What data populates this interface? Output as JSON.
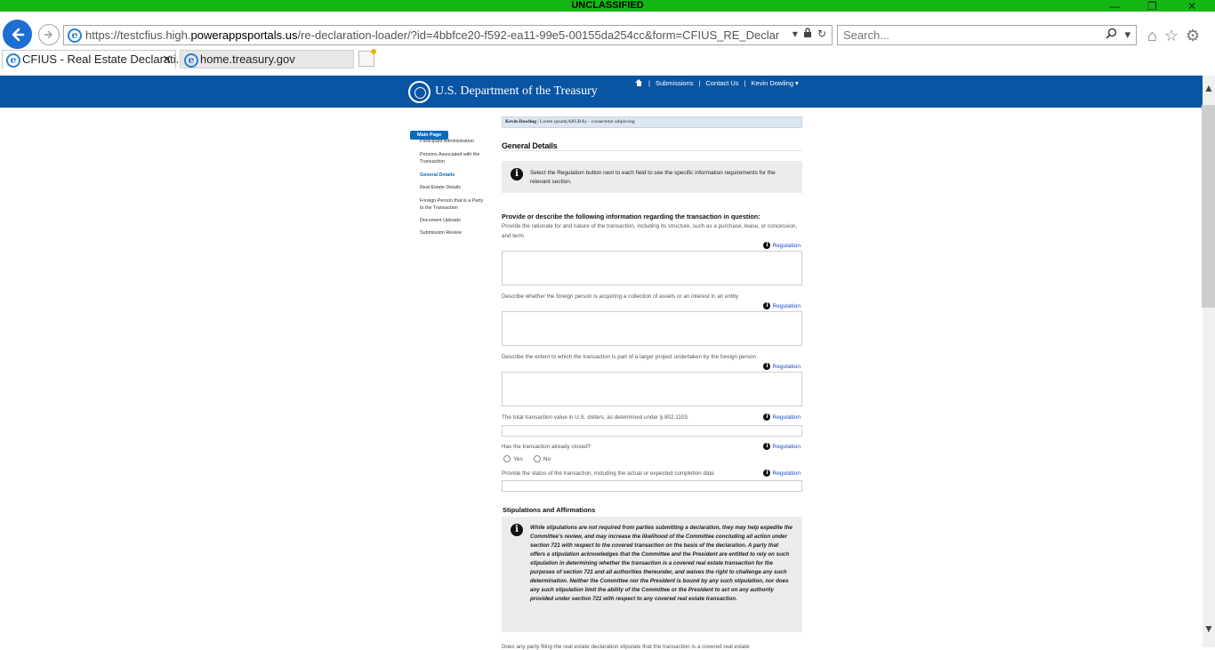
{
  "banner": {
    "text": "UNCLASSIFIED"
  },
  "browser": {
    "url": "https://testcfius.high.powerappsportals.us/re-declaration-loader/?id=4bbfce20-f592-ea11-99e5-00155da254cc&form=CFIUS_RE_Declaration_Gen_De",
    "url_prefix": "https://testcfius.high.",
    "url_domain": "powerappsportals.us",
    "url_path": "/re-declaration-loader/?id=4bbfce20-f592-ea11-99e5-00155da254cc&form=CFIUS_RE_Declaration_Gen_De",
    "search_placeholder": "Search...",
    "tabs": [
      {
        "label": "CFIUS - Real Estate Declarati...",
        "active": true
      },
      {
        "label": "home.treasury.gov",
        "active": false
      }
    ]
  },
  "header": {
    "dept_name": "U.S. Department of the Treasury",
    "nav": [
      "Submissions",
      "Contact Us",
      "Kevin Dowling"
    ],
    "nav_user_caret": "⌵"
  },
  "leftnav": {
    "main_page": "Main Page",
    "items": [
      {
        "label": "Participant Administration",
        "active": false
      },
      {
        "label": "Persons Associated with the Transaction",
        "active": false
      },
      {
        "label": "General Details",
        "active": true
      },
      {
        "label": "Real Estate Details",
        "active": false
      },
      {
        "label": "Foreign Person that is a Party to the Transaction",
        "active": false
      },
      {
        "label": "Document Uploads",
        "active": false
      },
      {
        "label": "Submission Review",
        "active": false
      }
    ]
  },
  "content": {
    "user_name": "Kevin Dowling",
    "user_detail": "Lorem ipsum(ARUBA) – consectetur adipiscing",
    "title": "General Details",
    "info_text": "Select the Regulation button next to each field to see the specific information requirements for the relevant section.",
    "provide_heading": "Provide or describe the following information regarding the transaction in question:",
    "regulation_label": "Regulation",
    "questions": [
      "Provide the rationale for and nature of the transaction, including its structure, such as a purchase, lease, or concession, and term",
      "Describe whether the foreign person is acquiring a collection of assets or an interest in an entity",
      "Describe the extent to which the transaction is part of a larger project undertaken by the foreign person",
      "The total transaction value in U.S. dollars, as determined under § 802.1103.",
      "Has the transaction already closed?",
      "Provide the status of the transaction, including the actual or expected completion date"
    ],
    "radio_yes": "Yes",
    "radio_no": "No",
    "stipulations_heading": "Stipulations and Affirmations",
    "stipulations_text": "While stipulations are not required from parties submitting a declaration, they may help expedite the Committee's review, and may increase the likelihood of the Committee concluding all action under section 721 with respect to the covered transaction on the basis of the declaration. A party that offers a stipulation acknowledges that the Committee and the President are entitled to rely on such stipulation in determining whether the transaction is a covered real estate transaction for the purposes of section 721 and all authorities thereunder, and waives the right to challenge any such determination. Neither the Committee nor the President is bound by any such stipulation, nor does any such stipulation limit the ability of the Committee or the President to act on any authority provided under section 721 with respect to any covered real estate transaction.",
    "cut_text": "Does any party filing the real estate declaration stipulate that the transaction is a covered real estate"
  }
}
